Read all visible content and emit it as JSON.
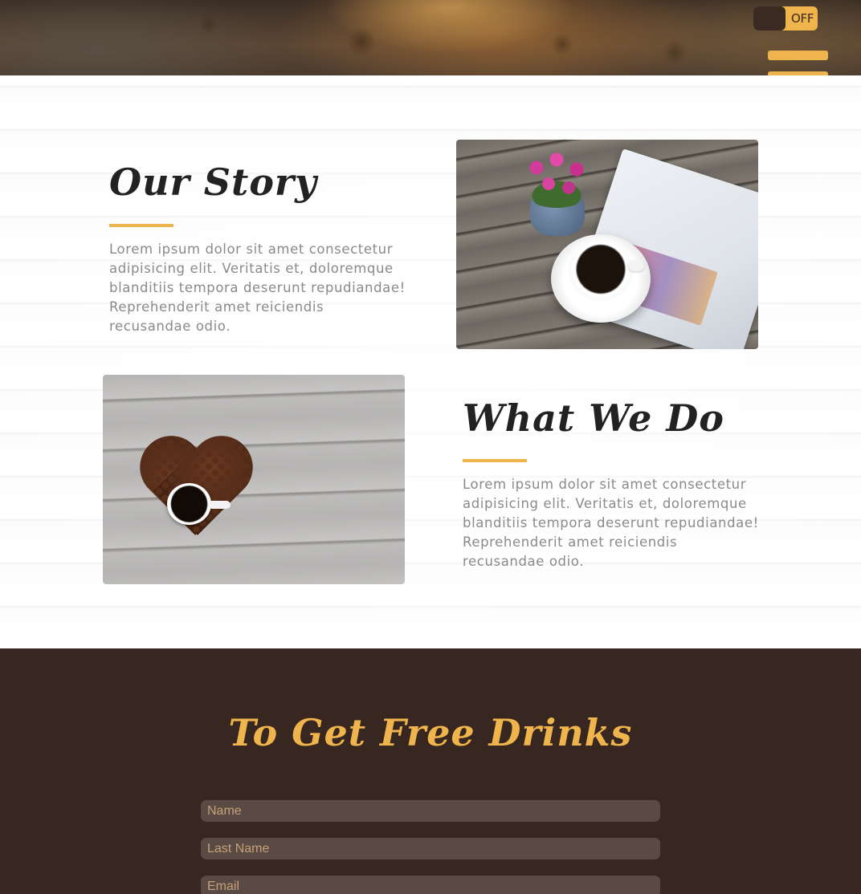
{
  "header": {
    "toggle_label": "OFF"
  },
  "story": {
    "title": "Our Story",
    "text": "Lorem ipsum dolor sit amet consectetur adipisicing elit. Veritatis et, doloremque blanditiis tempora deserunt repudiandae! Reprehenderit amet reiciendis recusandae odio."
  },
  "what": {
    "title": "What We Do",
    "text": "Lorem ipsum dolor sit amet consectetur adipisicing elit. Veritatis et, doloremque blanditiis tempora deserunt repudiandae! Reprehenderit amet reiciendis recusandae odio."
  },
  "signup": {
    "title": "To Get Free Drinks",
    "name_placeholder": "Name",
    "last_name_placeholder": "Last Name",
    "email_placeholder": "Email"
  },
  "colors": {
    "accent": "#f0b44c",
    "dark_brown": "#372720",
    "field_bg": "#5a4a44",
    "text_gray": "#8a8a8a"
  }
}
